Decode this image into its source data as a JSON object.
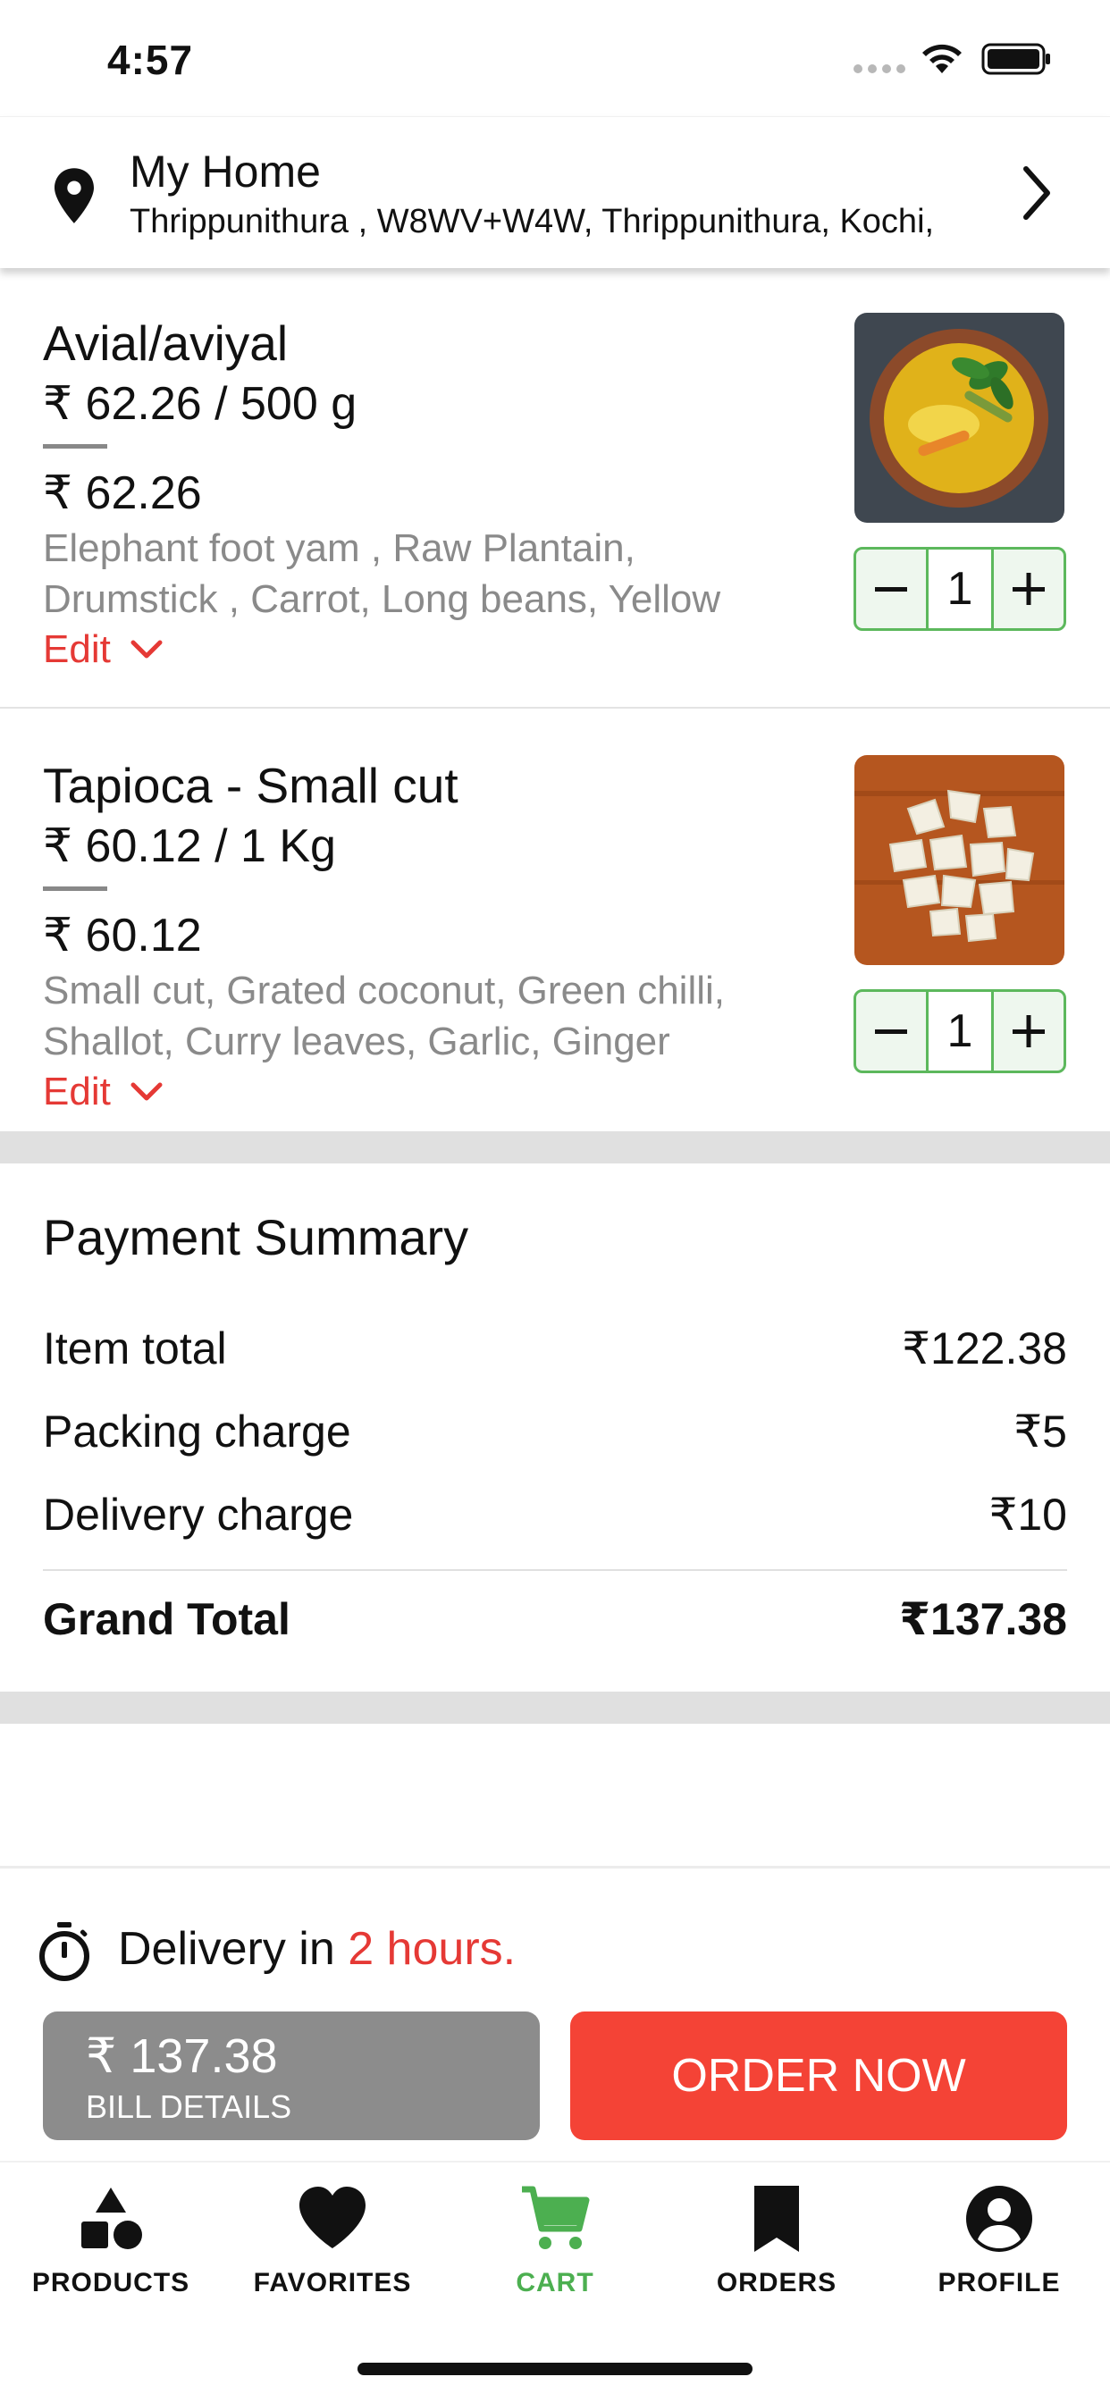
{
  "status_bar": {
    "time": "4:57"
  },
  "address": {
    "title": "My Home",
    "line": "Thrippunithura , W8WV+W4W, Thrippunithura, Kochi,"
  },
  "items": [
    {
      "name": "Avial/aviyal",
      "unit_price": "₹ 62.26 / 500 g",
      "price": "₹ 62.26",
      "description": "Elephant foot yam , Raw Plantain, Drumstick , Carrot, Long beans, Yellow",
      "edit_label": "Edit",
      "quantity": "1"
    },
    {
      "name": "Tapioca - Small cut",
      "unit_price": "₹ 60.12 / 1 Kg",
      "price": "₹ 60.12",
      "description": "Small cut, Grated coconut, Green chilli, Shallot, Curry leaves, Garlic, Ginger",
      "edit_label": "Edit",
      "quantity": "1"
    }
  ],
  "payment": {
    "title": "Payment Summary",
    "rows": [
      {
        "label": "Item total",
        "value": "₹122.38"
      },
      {
        "label": "Packing charge",
        "value": "₹5"
      },
      {
        "label": "Delivery charge",
        "value": "₹10"
      }
    ],
    "grand_label": "Grand Total",
    "grand_value": "₹137.38"
  },
  "delivery": {
    "prefix": "Delivery in ",
    "highlight": "2 hours."
  },
  "bill": {
    "amount": "₹ 137.38",
    "label": "BILL DETAILS"
  },
  "order_button": "ORDER NOW",
  "tabs": [
    {
      "label": "PRODUCTS",
      "icon": "shapes-icon"
    },
    {
      "label": "FAVORITES",
      "icon": "heart-icon"
    },
    {
      "label": "CART",
      "icon": "cart-icon",
      "active": true
    },
    {
      "label": "ORDERS",
      "icon": "bookmark-icon"
    },
    {
      "label": "PROFILE",
      "icon": "account-icon"
    }
  ],
  "colors": {
    "accent_red": "#f44336",
    "active_green": "#4caf50",
    "stepper_green": "#5cb85c",
    "bill_gray": "#8c8c8c"
  }
}
